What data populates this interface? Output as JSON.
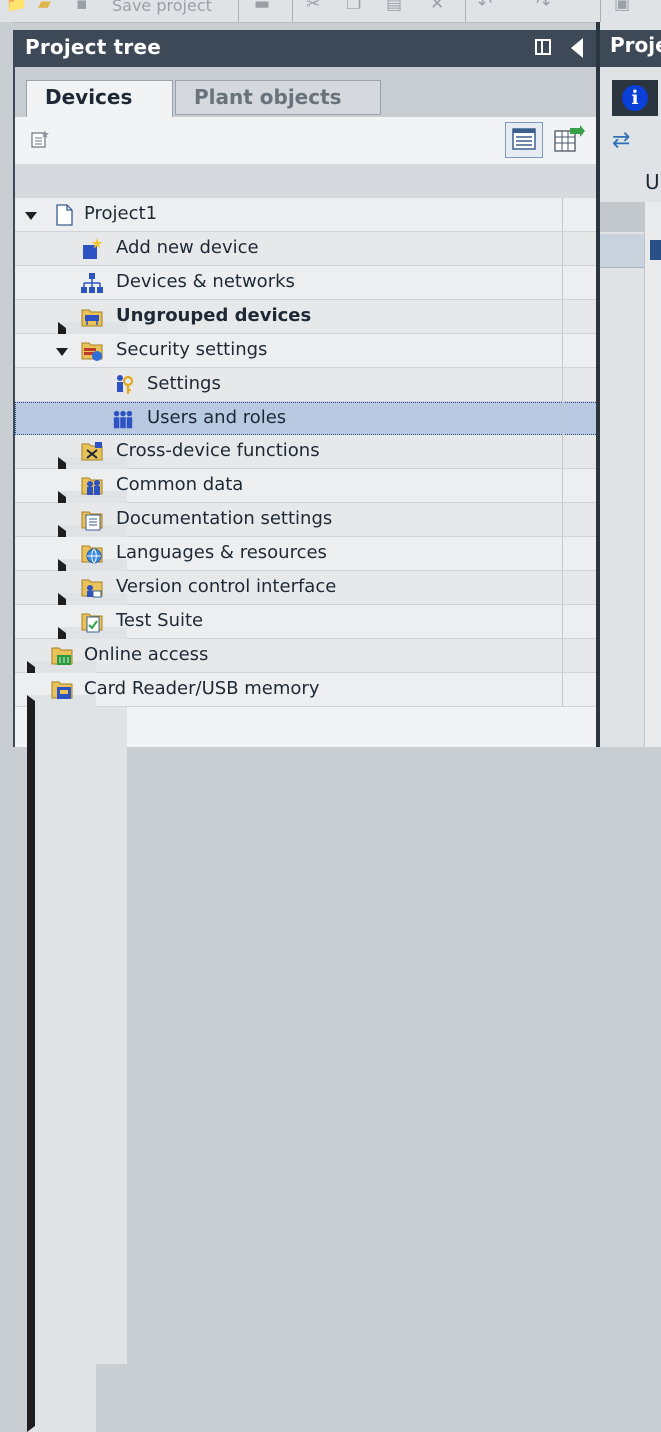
{
  "toolbar": {
    "save_label": "Save project",
    "icons": [
      "open-folder-icon",
      "save-icon",
      "print-icon",
      "cut-icon",
      "copy-icon",
      "paste-icon",
      "delete-icon",
      "undo-icon",
      "redo-icon",
      "compile-icon"
    ]
  },
  "panel": {
    "title": "Project tree",
    "tabs": [
      {
        "label": "Devices",
        "active": true
      },
      {
        "label": "Plant objects",
        "active": false
      }
    ]
  },
  "tree": {
    "items": [
      {
        "label": "Project1",
        "icon": "project-file-icon",
        "expand": "down",
        "bold": false
      },
      {
        "label": "Add new device",
        "icon": "add-device-icon",
        "expand": "none",
        "bold": false
      },
      {
        "label": "Devices & networks",
        "icon": "network-icon",
        "expand": "none",
        "bold": false
      },
      {
        "label": "Ungrouped devices",
        "icon": "device-group-icon",
        "expand": "right",
        "bold": true
      },
      {
        "label": "Security settings",
        "icon": "security-folder-icon",
        "expand": "down",
        "bold": false
      },
      {
        "label": "Settings",
        "icon": "settings-key-icon",
        "expand": "none",
        "bold": false
      },
      {
        "label": "Users and roles",
        "icon": "users-icon",
        "expand": "none",
        "bold": false,
        "selected": true
      },
      {
        "label": "Cross-device functions",
        "icon": "cross-device-icon",
        "expand": "right",
        "bold": false
      },
      {
        "label": "Common data",
        "icon": "common-data-icon",
        "expand": "right",
        "bold": false
      },
      {
        "label": "Documentation settings",
        "icon": "documentation-icon",
        "expand": "right",
        "bold": false
      },
      {
        "label": "Languages & resources",
        "icon": "languages-globe-icon",
        "expand": "right",
        "bold": false
      },
      {
        "label": "Version control interface",
        "icon": "version-control-icon",
        "expand": "right",
        "bold": false
      },
      {
        "label": "Test Suite",
        "icon": "test-suite-icon",
        "expand": "right",
        "bold": false
      },
      {
        "label": "Online access",
        "icon": "online-access-icon",
        "expand": "right",
        "bold": false
      },
      {
        "label": "Card Reader/USB memory",
        "icon": "card-reader-icon",
        "expand": "right",
        "bold": false
      }
    ]
  },
  "right_pane": {
    "title_fragment": "Proje",
    "column_fragment": "U",
    "info_glyph": "i"
  },
  "colors": {
    "header_bg": "#3d4957",
    "selection_bg": "#b9c9e2",
    "info_blue": "#0a3fd8"
  }
}
